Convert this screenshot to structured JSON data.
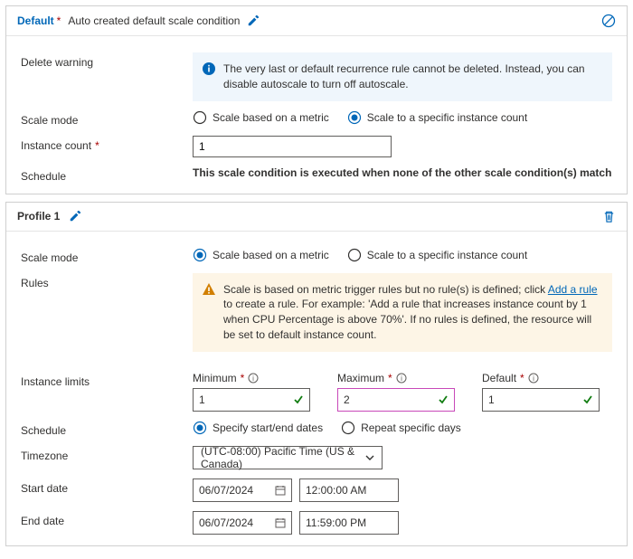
{
  "card1": {
    "title": "Default",
    "subtitle": "Auto created default scale condition",
    "deleteWarningLabel": "Delete warning",
    "deleteWarningText": "The very last or default recurrence rule cannot be deleted. Instead, you can disable autoscale to turn off autoscale.",
    "scaleModeLabel": "Scale mode",
    "radioMetric": "Scale based on a metric",
    "radioCount": "Scale to a specific instance count",
    "instanceCountLabel": "Instance count",
    "instanceCountValue": "1",
    "scheduleLabel": "Schedule",
    "scheduleText": "This scale condition is executed when none of the other scale condition(s) match"
  },
  "card2": {
    "title": "Profile 1",
    "scaleModeLabel": "Scale mode",
    "radioMetric": "Scale based on a metric",
    "radioCount": "Scale to a specific instance count",
    "rulesLabel": "Rules",
    "rulesTextPre": "Scale is based on metric trigger rules but no rule(s) is defined; click ",
    "addRuleLink": "Add a rule",
    "rulesTextPost": " to create a rule. For example: 'Add a rule that increases instance count by 1 when CPU Percentage is above 70%'. If no rules is defined, the resource will be set to default instance count.",
    "limitsLabel": "Instance limits",
    "min": {
      "label": "Minimum",
      "value": "1"
    },
    "max": {
      "label": "Maximum",
      "value": "2"
    },
    "def": {
      "label": "Default",
      "value": "1"
    },
    "scheduleLabel": "Schedule",
    "radioDates": "Specify start/end dates",
    "radioDays": "Repeat specific days",
    "tzLabel": "Timezone",
    "tzValue": "(UTC-08:00) Pacific Time (US & Canada)",
    "startLabel": "Start date",
    "startDate": "06/07/2024",
    "startTime": "12:00:00 AM",
    "endLabel": "End date",
    "endDate": "06/07/2024",
    "endTime": "11:59:00 PM"
  }
}
